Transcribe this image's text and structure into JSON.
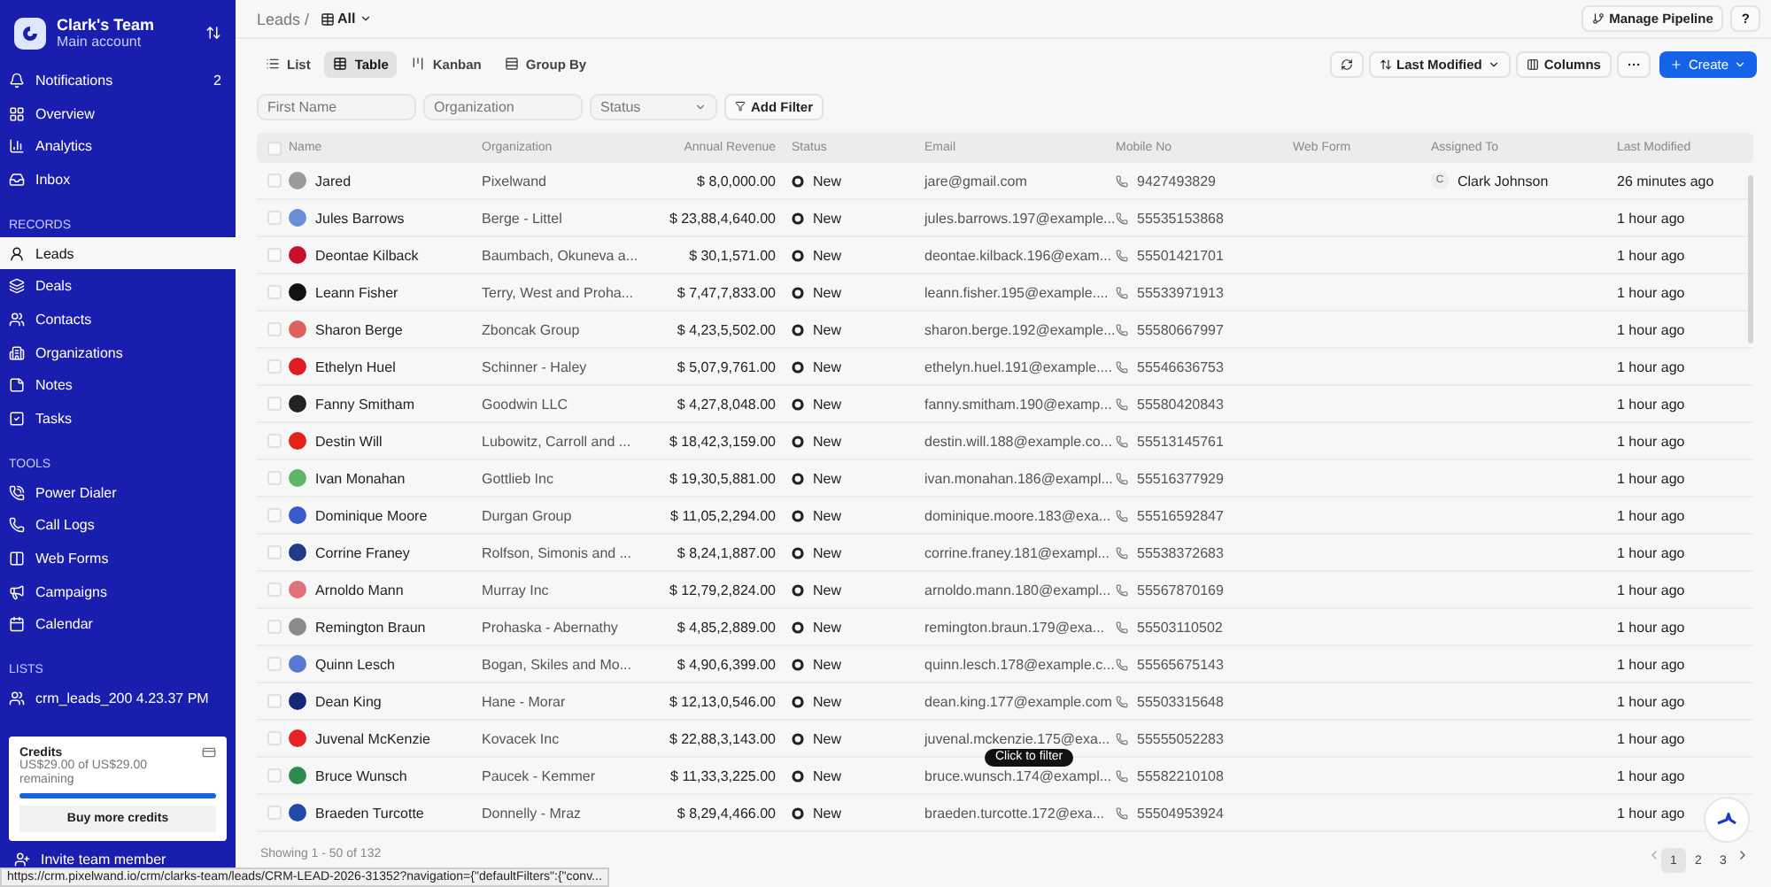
{
  "sidebar": {
    "team": "Clark's Team",
    "account": "Main account",
    "top_items": [
      {
        "label": "Notifications",
        "badge": "2",
        "selected": false
      },
      {
        "label": "Overview",
        "selected": false
      },
      {
        "label": "Analytics",
        "selected": false
      },
      {
        "label": "Inbox",
        "selected": false
      }
    ],
    "sections": [
      {
        "title": "RECORDS",
        "items": [
          {
            "label": "Leads",
            "selected": true
          },
          {
            "label": "Deals",
            "selected": false
          },
          {
            "label": "Contacts",
            "selected": false
          },
          {
            "label": "Organizations",
            "selected": false
          },
          {
            "label": "Notes",
            "selected": false
          },
          {
            "label": "Tasks",
            "selected": false
          }
        ]
      },
      {
        "title": "TOOLS",
        "items": [
          {
            "label": "Power Dialer",
            "selected": false
          },
          {
            "label": "Call Logs",
            "selected": false
          },
          {
            "label": "Web Forms",
            "selected": false
          },
          {
            "label": "Campaigns",
            "selected": false
          },
          {
            "label": "Calendar",
            "selected": false
          }
        ]
      },
      {
        "title": "LISTS",
        "items": [
          {
            "label": "crm_leads_200 4.23.37 PM",
            "selected": false
          }
        ]
      }
    ],
    "credits": {
      "title": "Credits",
      "text": "US$29.00 of US$29.00 remaining",
      "level": 1.0,
      "button": "Buy more credits"
    },
    "invite": "Invite team member"
  },
  "header": {
    "breadcrumb": "Leads /",
    "view": "All",
    "manage": "Manage Pipeline",
    "help": "?"
  },
  "view_tabs": [
    {
      "label": "List",
      "selected": false
    },
    {
      "label": "Table",
      "selected": true
    },
    {
      "label": "Kanban",
      "selected": false
    },
    {
      "label": "Group By",
      "selected": false
    }
  ],
  "toolbar": {
    "sort": "Last Modified",
    "columns": "Columns",
    "more": "···",
    "create": "Create"
  },
  "filters": {
    "first_name": {
      "placeholder": "First Name"
    },
    "organization": {
      "placeholder": "Organization"
    },
    "status": {
      "placeholder": "Status"
    },
    "add": "Add Filter"
  },
  "table": {
    "select_all": {
      "checked": false
    },
    "columns": [
      "Name",
      "Organization",
      "Annual Revenue",
      "Status",
      "Email",
      "Mobile No",
      "Web Form",
      "Assigned To",
      "Last Modified"
    ],
    "rows": [
      {
        "checked": false,
        "color": "#9a9a9a",
        "name": "Jared",
        "organization": "Pixelwand",
        "revenue": "$ 8,0,000.00",
        "status": "New",
        "email": "jare@gmail.com",
        "mobile": "9427493829",
        "assigned_initial": "C",
        "assigned": "Clark Johnson",
        "modified": "26 minutes ago"
      },
      {
        "checked": false,
        "color": "#6b8fd6",
        "name": "Jules Barrows",
        "organization": "Berge - Littel",
        "revenue": "$ 23,88,4,640.00",
        "status": "New",
        "email": "jules.barrows.197@example...",
        "mobile": "55535153868",
        "modified": "1 hour ago"
      },
      {
        "checked": false,
        "color": "#c8102e",
        "name": "Deontae Kilback",
        "organization": "Baumbach, Okuneva a...",
        "revenue": "$ 30,1,571.00",
        "status": "New",
        "email": "deontae.kilback.196@exam...",
        "mobile": "55501421701",
        "modified": "1 hour ago"
      },
      {
        "checked": false,
        "color": "#111111",
        "name": "Leann Fisher",
        "organization": "Terry, West and Proha...",
        "revenue": "$ 7,47,7,833.00",
        "status": "New",
        "email": "leann.fisher.195@example....",
        "mobile": "55533971913",
        "modified": "1 hour ago"
      },
      {
        "checked": false,
        "color": "#e06060",
        "name": "Sharon Berge",
        "organization": "Zboncak Group",
        "revenue": "$ 4,23,5,502.00",
        "status": "New",
        "email": "sharon.berge.192@example...",
        "mobile": "55580667997",
        "modified": "1 hour ago"
      },
      {
        "checked": false,
        "color": "#e31b23",
        "name": "Ethelyn Huel",
        "organization": "Schinner - Haley",
        "revenue": "$ 5,07,9,761.00",
        "status": "New",
        "email": "ethelyn.huel.191@example....",
        "mobile": "55546636753",
        "modified": "1 hour ago"
      },
      {
        "checked": false,
        "color": "#222222",
        "name": "Fanny Smitham",
        "organization": "Goodwin LLC",
        "revenue": "$ 4,27,8,048.00",
        "status": "New",
        "email": "fanny.smitham.190@examp...",
        "mobile": "55580420843",
        "modified": "1 hour ago"
      },
      {
        "checked": false,
        "color": "#e2231a",
        "name": "Destin Will",
        "organization": "Lubowitz, Carroll and ...",
        "revenue": "$ 18,42,3,159.00",
        "status": "New",
        "email": "destin.will.188@example.co...",
        "mobile": "55513145761",
        "modified": "1 hour ago"
      },
      {
        "checked": false,
        "color": "#5fb36b",
        "name": "Ivan Monahan",
        "organization": "Gottlieb Inc",
        "revenue": "$ 19,30,5,881.00",
        "status": "New",
        "email": "ivan.monahan.186@exampl...",
        "mobile": "55516377929",
        "modified": "1 hour ago"
      },
      {
        "checked": false,
        "color": "#3a5ac8",
        "name": "Dominique Moore",
        "organization": "Durgan Group",
        "revenue": "$ 11,05,2,294.00",
        "status": "New",
        "email": "dominique.moore.183@exa...",
        "mobile": "55516592847",
        "modified": "1 hour ago"
      },
      {
        "checked": false,
        "color": "#1e3a8a",
        "name": "Corrine Franey",
        "organization": "Rolfson, Simonis and ...",
        "revenue": "$ 8,24,1,887.00",
        "status": "New",
        "email": "corrine.franey.181@exampl...",
        "mobile": "55538372683",
        "modified": "1 hour ago"
      },
      {
        "checked": false,
        "color": "#e0707a",
        "name": "Arnoldo Mann",
        "organization": "Murray Inc",
        "revenue": "$ 12,79,2,824.00",
        "status": "New",
        "email": "arnoldo.mann.180@exampl...",
        "mobile": "55567870169",
        "modified": "1 hour ago"
      },
      {
        "checked": false,
        "color": "#8a8a8a",
        "name": "Remington Braun",
        "organization": "Prohaska - Abernathy",
        "revenue": "$ 4,85,2,889.00",
        "status": "New",
        "email": "remington.braun.179@exa...",
        "mobile": "55503110502",
        "modified": "1 hour ago"
      },
      {
        "checked": false,
        "color": "#5a78d0",
        "name": "Quinn Lesch",
        "organization": "Bogan, Skiles and Mo...",
        "revenue": "$ 4,90,6,399.00",
        "status": "New",
        "email": "quinn.lesch.178@example.c...",
        "mobile": "55565675143",
        "modified": "1 hour ago"
      },
      {
        "checked": false,
        "color": "#14287a",
        "name": "Dean King",
        "organization": "Hane - Morar",
        "revenue": "$ 12,13,0,546.00",
        "status": "New",
        "email": "dean.king.177@example.com",
        "mobile": "55503315648",
        "modified": "1 hour ago"
      },
      {
        "checked": false,
        "color": "#e82127",
        "name": "Juvenal McKenzie",
        "organization": "Kovacek Inc",
        "revenue": "$ 22,88,3,143.00",
        "status": "New",
        "email": "juvenal.mckenzie.175@exa...",
        "mobile": "55555052283",
        "modified": "1 hour ago"
      },
      {
        "checked": false,
        "color": "#2f8a4e",
        "name": "Bruce Wunsch",
        "organization": "Paucek - Kemmer",
        "revenue": "$ 11,33,3,225.00",
        "status": "New",
        "email": "bruce.wunsch.174@exampl...",
        "mobile": "55582210108",
        "modified": "1 hour ago"
      },
      {
        "checked": false,
        "color": "#1f4aa8",
        "name": "Braeden Turcotte",
        "organization": "Donnelly - Mraz",
        "revenue": "$ 8,29,4,466.00",
        "status": "New",
        "email": "braeden.turcotte.172@exa...",
        "mobile": "55504953924",
        "modified": "1 hour ago"
      }
    ]
  },
  "tooltip": "Click to filter",
  "footer": {
    "showing": "Showing 1 - 50 of 132",
    "pages": [
      {
        "label": "1",
        "selected": true
      },
      {
        "label": "2",
        "selected": false
      },
      {
        "label": "3",
        "selected": false
      }
    ]
  },
  "status_url": "https://crm.pixelwand.io/crm/clarks-team/leads/CRM-LEAD-2026-31352?navigation={\"defaultFilters\":{\"conv..."
}
